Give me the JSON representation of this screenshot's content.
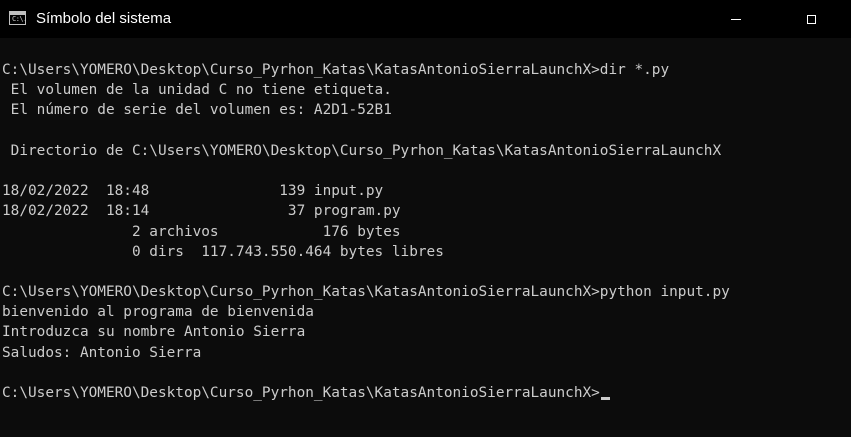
{
  "window": {
    "title": "Símbolo del sistema",
    "icon": "cmd-icon",
    "icon_glyph": "C:\\."
  },
  "console": {
    "lines": [
      "C:\\Users\\YOMERO\\Desktop\\Curso_Pyrhon_Katas\\KatasAntonioSierraLaunchX>dir *.py",
      " El volumen de la unidad C no tiene etiqueta.",
      " El número de serie del volumen es: A2D1-52B1",
      "",
      " Directorio de C:\\Users\\YOMERO\\Desktop\\Curso_Pyrhon_Katas\\KatasAntonioSierraLaunchX",
      "",
      "18/02/2022  18:48               139 input.py",
      "18/02/2022  18:14                37 program.py",
      "               2 archivos            176 bytes",
      "               0 dirs  117.743.550.464 bytes libres",
      "",
      "C:\\Users\\YOMERO\\Desktop\\Curso_Pyrhon_Katas\\KatasAntonioSierraLaunchX>python input.py",
      "bienvenido al programa de bienvenida",
      "Introduzca su nombre Antonio Sierra",
      "Saludos: Antonio Sierra",
      "",
      "C:\\Users\\YOMERO\\Desktop\\Curso_Pyrhon_Katas\\KatasAntonioSierraLaunchX>"
    ]
  },
  "colors": {
    "background": "#0c0c0c",
    "titlebar": "#000000",
    "text": "#cccccc"
  }
}
